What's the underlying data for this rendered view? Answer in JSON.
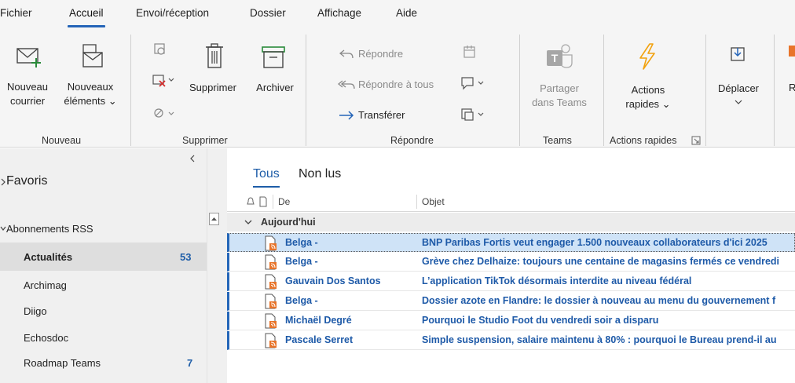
{
  "menu": {
    "tabs": [
      "Fichier",
      "Accueil",
      "Envoi/réception",
      "Dossier",
      "Affichage",
      "Aide"
    ],
    "active": "Accueil"
  },
  "ribbon": {
    "nouveau_courrier": [
      "Nouveau",
      "courrier"
    ],
    "nouveaux_elements": [
      "Nouveaux",
      "éléments ⌄"
    ],
    "supprimer": "Supprimer",
    "archiver": "Archiver",
    "repondre": "Répondre",
    "repondre_tous": "Répondre à tous",
    "transferer": "Transférer",
    "partager_teams": [
      "Partager",
      "dans Teams"
    ],
    "actions_rapides": [
      "Actions",
      "rapides ⌄"
    ],
    "deplacer": "Déplacer",
    "r_cut": "R",
    "groups": {
      "nouveau": "Nouveau",
      "supprimer": "Supprimer",
      "repondre": "Répondre",
      "teams": "Teams",
      "actions_rapides": "Actions rapides"
    },
    "accent": "#2464b8",
    "lightning_color": "#f2a20f"
  },
  "nav": {
    "favoris": "Favoris",
    "abonnements": "Abonnements RSS",
    "folders": [
      {
        "name": "Actualités",
        "count": "53",
        "selected": true
      },
      {
        "name": "Archimag",
        "count": ""
      },
      {
        "name": "Diigo",
        "count": ""
      },
      {
        "name": "Echosdoc",
        "count": ""
      },
      {
        "name": "Roadmap Teams",
        "count": "7"
      }
    ]
  },
  "list": {
    "filters": [
      "Tous",
      "Non lus"
    ],
    "columns": {
      "from": "De",
      "subject": "Objet"
    },
    "group": "Aujourd'hui",
    "rows": [
      {
        "from": "Belga -",
        "subject": "BNP Paribas Fortis veut engager 1.500 nouveaux collaborateurs d'ici 2025",
        "selected": true
      },
      {
        "from": "Belga -",
        "subject": "Grève chez Delhaize: toujours une centaine de magasins fermés ce vendredi"
      },
      {
        "from": "Gauvain Dos Santos",
        "subject": "L’application TikTok désormais interdite au niveau fédéral"
      },
      {
        "from": "Belga -",
        "subject": "Dossier azote en Flandre: le dossier à nouveau au menu du gouvernement f"
      },
      {
        "from": "Michaël Degré",
        "subject": "Pourquoi le Studio Foot du vendredi soir a disparu"
      },
      {
        "from": "Pascale Serret",
        "subject": "Simple suspension, salaire maintenu à 80%  : pourquoi le Bureau prend-il au"
      }
    ]
  }
}
